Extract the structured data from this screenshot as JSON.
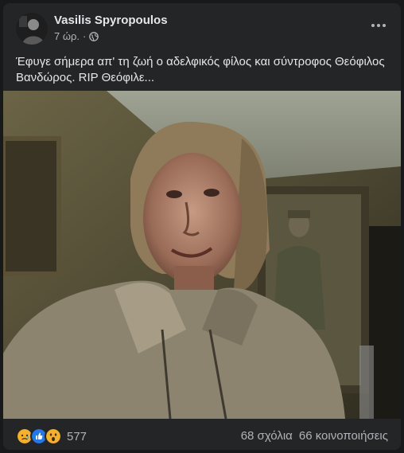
{
  "post": {
    "author": "Vasilis Spyropoulos",
    "time": "7 ώρ.",
    "separator": "·",
    "privacy_icon": "globe-icon",
    "more_icon": "ellipsis-icon",
    "text": "Έφυγε σήμερα απ' τη ζωή ο αδελφικός φίλος και σύντροφος Θεόφιλος Βανδώρος. RIP Θεόφιλε..."
  },
  "reactions": {
    "icons": [
      "sad-reaction-icon",
      "like-reaction-icon",
      "wow-reaction-icon"
    ],
    "count": "577"
  },
  "stats": {
    "comments": "68 σχόλια",
    "shares": "66 κοινοποιήσεις"
  },
  "colors": {
    "background": "#18191a",
    "card": "#242526",
    "primary_text": "#e4e6eb",
    "secondary_text": "#b0b3b8",
    "like_blue": "#2078f4",
    "reaction_yellow": "#f7b125"
  }
}
